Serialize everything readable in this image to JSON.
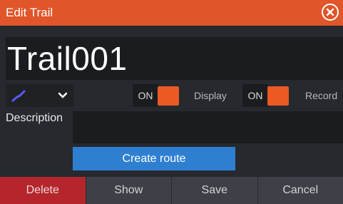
{
  "titlebar": {
    "title": "Edit Trail",
    "color": "#e0552a",
    "close_icon": "close-circle-icon"
  },
  "name_field": {
    "value": "Trail001"
  },
  "color_picker": {
    "icon": "trail-color-icon",
    "swatch_color": "#5a5aff"
  },
  "display_toggle": {
    "state": "ON",
    "label": "Display",
    "on_color": "#ea5a22"
  },
  "record_toggle": {
    "state": "ON",
    "label": "Record",
    "on_color": "#ea5a22"
  },
  "description": {
    "label": "Description",
    "value": ""
  },
  "create_route": {
    "label": "Create route",
    "color": "#2f7fd1"
  },
  "footer": {
    "delete": "Delete",
    "show": "Show",
    "save": "Save",
    "cancel": "Cancel",
    "delete_color": "#b4262b"
  }
}
